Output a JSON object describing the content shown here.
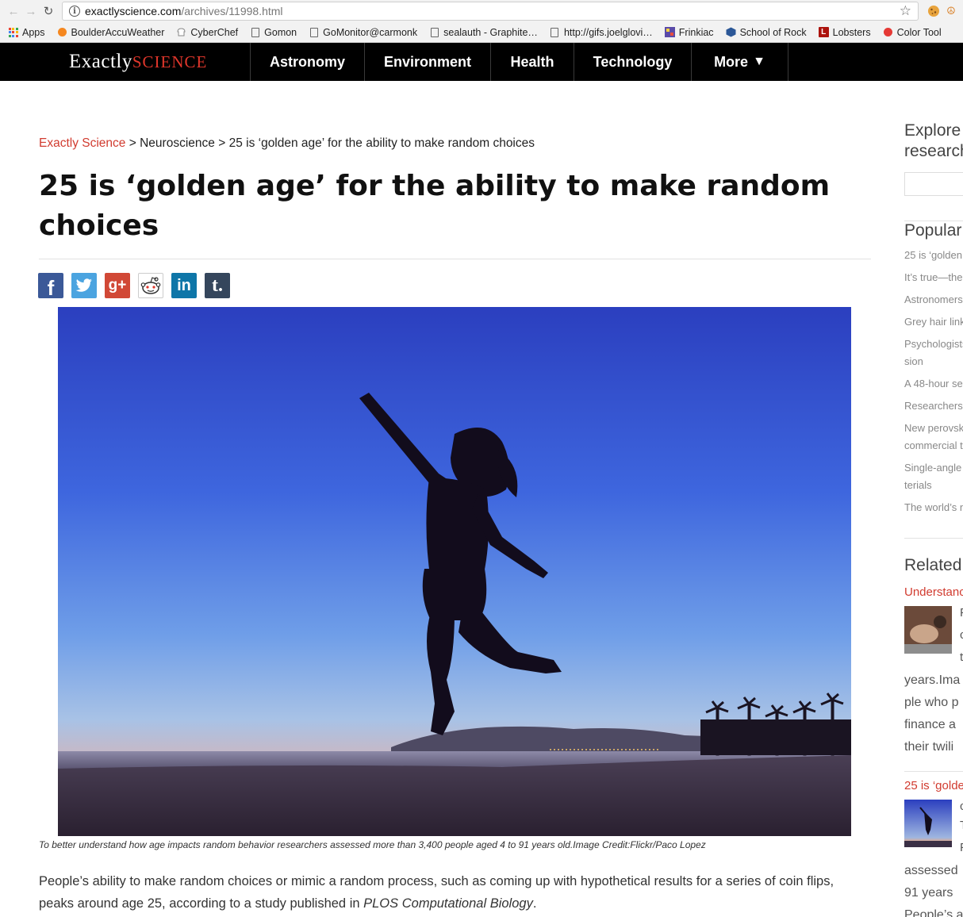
{
  "browser": {
    "url_host": "exactlyscience.com",
    "url_path": "/archives/11998.html",
    "bookmarks": [
      {
        "label": "Apps",
        "icon": "apps-grid-icon"
      },
      {
        "label": "BoulderAccuWeather",
        "icon": "sun-icon"
      },
      {
        "label": "CyberChef",
        "icon": "chef-hat-icon"
      },
      {
        "label": "Gomon",
        "icon": "page-icon"
      },
      {
        "label": "GoMonitor@carmonk",
        "icon": "page-icon"
      },
      {
        "label": "sealauth - Graphite…",
        "icon": "page-icon"
      },
      {
        "label": "http://gifs.joelglovi…",
        "icon": "page-icon"
      },
      {
        "label": "Frinkiac",
        "icon": "frinkiac-icon"
      },
      {
        "label": "School of Rock",
        "icon": "cube-icon"
      },
      {
        "label": "Lobsters",
        "icon": "lobsters-icon"
      },
      {
        "label": "Color Tool",
        "icon": "color-icon"
      }
    ]
  },
  "site": {
    "logo_part1": "Exactly",
    "logo_part2": "SCIENCE",
    "nav": [
      "Astronomy",
      "Environment",
      "Health",
      "Technology",
      "More"
    ]
  },
  "article": {
    "breadcrumb_home": "Exactly Science",
    "breadcrumb_sep": ">",
    "breadcrumb_section": "Neuroscience",
    "breadcrumb_current": "25 is ‘golden age’ for the ability to make random choices",
    "title": "25 is ‘golden age’ for the ability to make random choices",
    "share_buttons": [
      "facebook",
      "twitter",
      "google-plus",
      "reddit",
      "linkedin",
      "tumblr"
    ],
    "caption": "To better understand how age impacts random behavior researchers assessed more than 3,400 people aged 4 to 91 years old.Image Credit:Flickr/Paco Lopez",
    "body_1": "People’s ability to make random choices or mimic a random process, such as coming up with hypothetical results for a series of coin flips, peaks around age 25, according to a study published in ",
    "body_journal": "PLOS Computational Biology",
    "body_2": "."
  },
  "sidebar": {
    "explore_l1": "Explore",
    "explore_l2": "research",
    "popular_heading": "Popular",
    "popular": [
      "25 is ‘golden",
      "It’s true—the",
      "Astronomers",
      "Grey hair link",
      "Psychologists",
      "sion",
      "A 48-hour se",
      "Researchers",
      "New perovsk",
      "commercial t",
      "Single-angle",
      "terials",
      "The world’s n"
    ],
    "related_heading": "Related",
    "related_1_title": "Understanc",
    "related_1_lines": [
      "years.Ima",
      "ple who p",
      "finance a",
      "their twili"
    ],
    "related_1_frags": [
      "F",
      "c",
      "t"
    ],
    "related_2_title": "25 is ‘golde",
    "related_2_lines": [
      "assessed",
      "91 years",
      "People’s a"
    ],
    "related_2_frags": [
      "c",
      "T",
      "F"
    ]
  }
}
